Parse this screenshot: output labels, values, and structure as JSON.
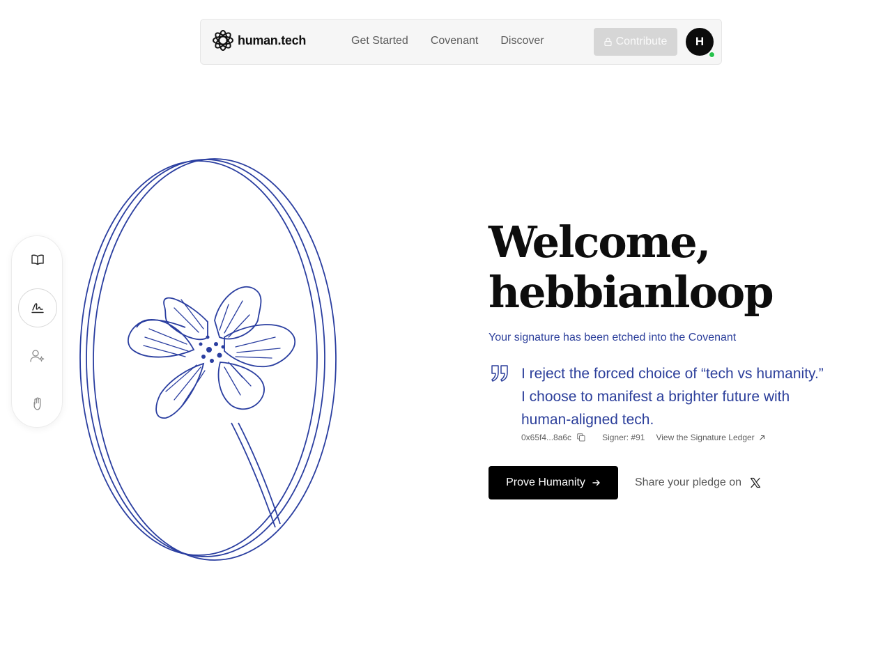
{
  "header": {
    "brand": "human.tech",
    "logo_icon": "human-tech-logo-icon",
    "nav": [
      {
        "label": "Get Started"
      },
      {
        "label": "Covenant"
      },
      {
        "label": "Discover"
      }
    ],
    "contribute_label": "Contribute",
    "contribute_icon": "lock-icon",
    "avatar_initial": "H",
    "status_color": "#27c24c"
  },
  "siderail": {
    "items": [
      {
        "icon": "book-icon"
      },
      {
        "icon": "signature-icon",
        "active": true
      },
      {
        "icon": "user-sparkle-icon"
      },
      {
        "icon": "hand-icon"
      }
    ]
  },
  "illustration": {
    "description_icon": "flower-medallion-icon",
    "stroke_color": "#2a3ea0"
  },
  "hero": {
    "title_line1": "Welcome,",
    "title_line2": "hebbianloop",
    "subtitle": "Your signature has been etched into the Covenant",
    "quote": "I reject the forced choice of “tech vs humanity.” I choose to manifest a brighter future with human-aligned tech.",
    "address": "0x65f4...8a6c",
    "signer": "Signer: #91",
    "ledger_link": "View the Signature Ledger",
    "prove_button": "Prove Humanity",
    "share_text": "Share your pledge on",
    "accent_color": "#2c3f9b"
  }
}
